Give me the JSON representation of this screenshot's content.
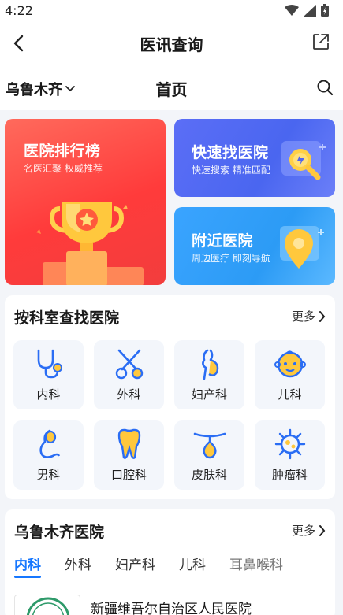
{
  "status": {
    "time": "4:22"
  },
  "nav": {
    "title": "医讯查询"
  },
  "header": {
    "city": "乌鲁木齐",
    "page_title": "首页"
  },
  "banners": {
    "ranking": {
      "title": "医院排行榜",
      "subtitle": "名医汇聚 权威推荐"
    },
    "fast_find": {
      "title": "快速找医院",
      "subtitle": "快速搜索 精准匹配"
    },
    "nearby": {
      "title": "附近医院",
      "subtitle": "周边医疗 即刻导航"
    }
  },
  "departments": {
    "title": "按科室查找医院",
    "more": "更多",
    "items": [
      {
        "label": "内科",
        "icon": "stethoscope-icon"
      },
      {
        "label": "外科",
        "icon": "scissors-icon"
      },
      {
        "label": "妇产科",
        "icon": "pregnant-icon"
      },
      {
        "label": "儿科",
        "icon": "baby-icon"
      },
      {
        "label": "男科",
        "icon": "male-icon"
      },
      {
        "label": "口腔科",
        "icon": "tooth-icon"
      },
      {
        "label": "皮肤科",
        "icon": "skin-icon"
      },
      {
        "label": "肿瘤科",
        "icon": "virus-icon"
      }
    ]
  },
  "hospitals": {
    "title": "乌鲁木齐医院",
    "more": "更多",
    "tabs": [
      "内科",
      "外科",
      "妇产科",
      "儿科",
      "耳鼻喉科"
    ],
    "active_tab": 0,
    "list": [
      {
        "name": "新疆维吾尔自治区人民医院"
      }
    ]
  },
  "colors": {
    "accent": "#1677ff",
    "rank": "#ff4a45",
    "fast": "#5066f2",
    "near": "#35a2fb",
    "icon_blue": "#2a6df4",
    "icon_yellow": "#ffc83d"
  }
}
